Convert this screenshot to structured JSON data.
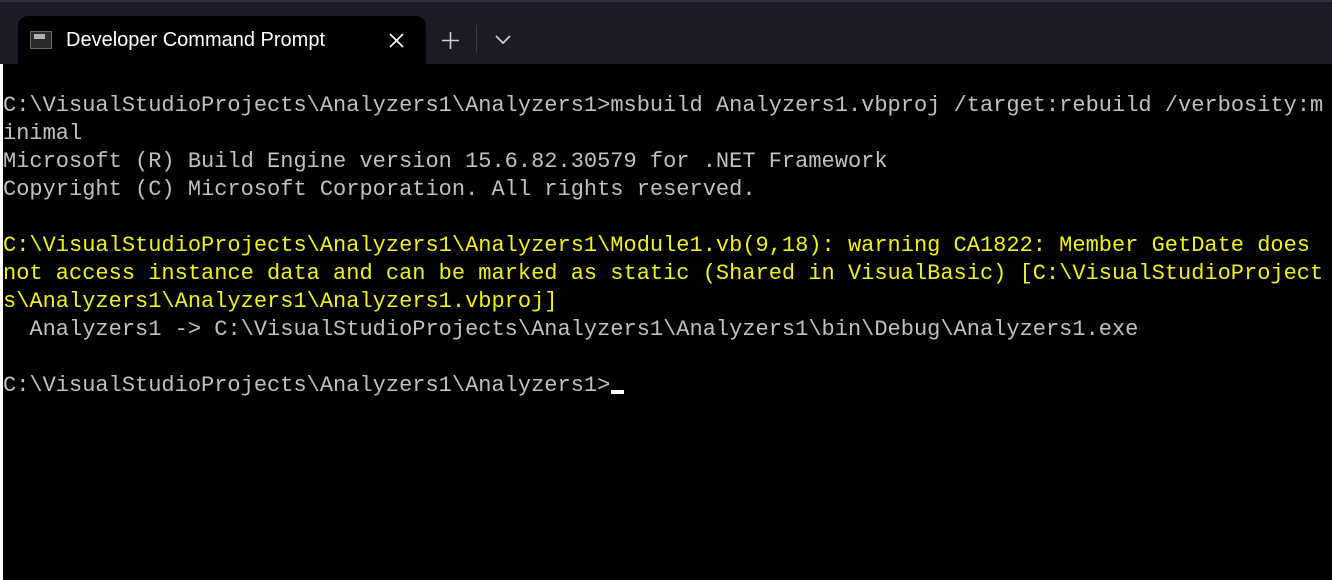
{
  "tab": {
    "title": "Developer Command Prompt"
  },
  "terminal": {
    "prompt1_path": "C:\\VisualStudioProjects\\Analyzers1\\Analyzers1>",
    "prompt1_cmd": "msbuild Analyzers1.vbproj /target:rebuild /verbosity:minimal",
    "banner_line1": "Microsoft (R) Build Engine version 15.6.82.30579 for .NET Framework",
    "banner_line2": "Copyright (C) Microsoft Corporation. All rights reserved.",
    "warning": "C:\\VisualStudioProjects\\Analyzers1\\Analyzers1\\Module1.vb(9,18): warning CA1822: Member GetDate does not access instance data and can be marked as static (Shared in VisualBasic) [C:\\VisualStudioProjects\\Analyzers1\\Analyzers1\\Analyzers1.vbproj]",
    "output_line": "  Analyzers1 -> C:\\VisualStudioProjects\\Analyzers1\\Analyzers1\\bin\\Debug\\Analyzers1.exe",
    "prompt2_path": "C:\\VisualStudioProjects\\Analyzers1\\Analyzers1>"
  }
}
